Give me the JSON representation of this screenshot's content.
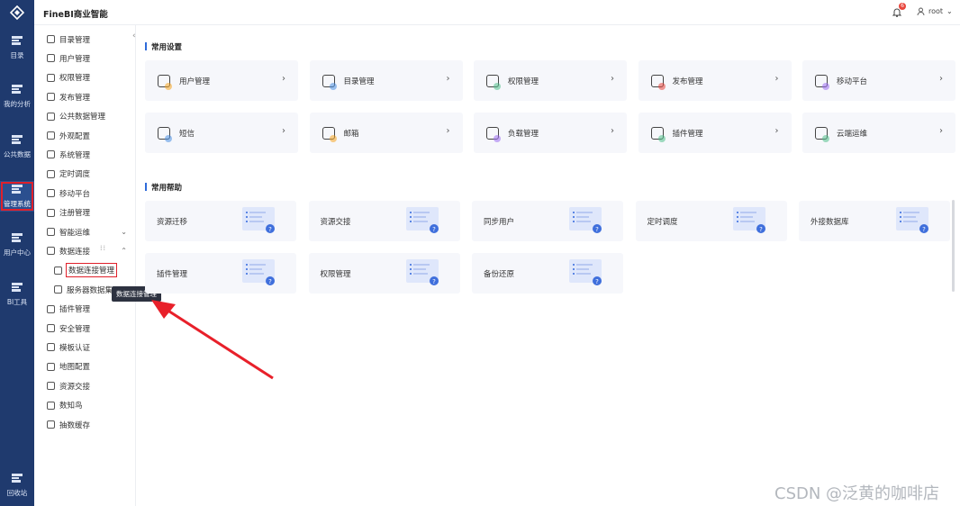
{
  "colors": {
    "rail_bg": "#1f3a6e",
    "accent": "#2f6bd9",
    "highlight": "#e0202a"
  },
  "app": {
    "title": "FineBI商业智能"
  },
  "header": {
    "notification_count": "6",
    "username": "root"
  },
  "rail": [
    {
      "label": "目录",
      "icon": "list-icon"
    },
    {
      "label": "我的分析",
      "icon": "chart-icon"
    },
    {
      "label": "公共数据",
      "icon": "database-icon"
    },
    {
      "label": "管理系统",
      "icon": "gear-icon",
      "active": true
    },
    {
      "label": "用户中心",
      "icon": "user-center-icon"
    },
    {
      "label": "BI工具",
      "icon": "toolbox-icon"
    },
    {
      "label": "回收站",
      "icon": "recycle-icon"
    }
  ],
  "sidemenu": [
    {
      "label": "目录管理"
    },
    {
      "label": "用户管理"
    },
    {
      "label": "权限管理"
    },
    {
      "label": "发布管理"
    },
    {
      "label": "公共数据管理"
    },
    {
      "label": "外观配置"
    },
    {
      "label": "系统管理"
    },
    {
      "label": "定时调度"
    },
    {
      "label": "移动平台"
    },
    {
      "label": "注册管理"
    },
    {
      "label": "智能运维",
      "chevron": "⌄"
    },
    {
      "label": "数据连接",
      "chevron": "⌃"
    },
    {
      "label": "数据连接管理",
      "sub": true,
      "selected": true
    },
    {
      "label": "服务器数据集",
      "sub": true
    },
    {
      "label": "插件管理"
    },
    {
      "label": "安全管理"
    },
    {
      "label": "模板认证"
    },
    {
      "label": "地图配置"
    },
    {
      "label": "资源交接"
    },
    {
      "label": "数知鸟"
    },
    {
      "label": "抽数缓存"
    }
  ],
  "tooltip": "数据连接管理",
  "sections": {
    "settings_title": "常用设置",
    "help_title": "常用帮助"
  },
  "settings_cards": [
    {
      "label": "用户管理",
      "icon": "user-icon",
      "dot": "#f5a623"
    },
    {
      "label": "目录管理",
      "icon": "catalog-icon",
      "dot": "#4a90e2"
    },
    {
      "label": "权限管理",
      "icon": "shield-icon",
      "dot": "#50c08a"
    },
    {
      "label": "发布管理",
      "icon": "publish-icon",
      "dot": "#e8453c"
    },
    {
      "label": "移动平台",
      "icon": "mobile-icon",
      "dot": "#9b6cf0"
    },
    {
      "label": "短信",
      "icon": "sms-icon",
      "dot": "#4a90e2"
    },
    {
      "label": "邮箱",
      "icon": "mail-icon",
      "dot": "#f5a623"
    },
    {
      "label": "负载管理",
      "icon": "load-icon",
      "dot": "#9b6cf0"
    },
    {
      "label": "插件管理",
      "icon": "plugin-icon",
      "dot": "#50c08a"
    },
    {
      "label": "云端运维",
      "icon": "cloud-icon",
      "dot": "#50c08a"
    }
  ],
  "help_cards": [
    {
      "label": "资源迁移"
    },
    {
      "label": "资源交接"
    },
    {
      "label": "同步用户"
    },
    {
      "label": "定时调度"
    },
    {
      "label": "外接数据库"
    },
    {
      "label": "插件管理"
    },
    {
      "label": "权限管理"
    },
    {
      "label": "备份还原"
    }
  ],
  "watermark": "CSDN @泛黄的咖啡店"
}
